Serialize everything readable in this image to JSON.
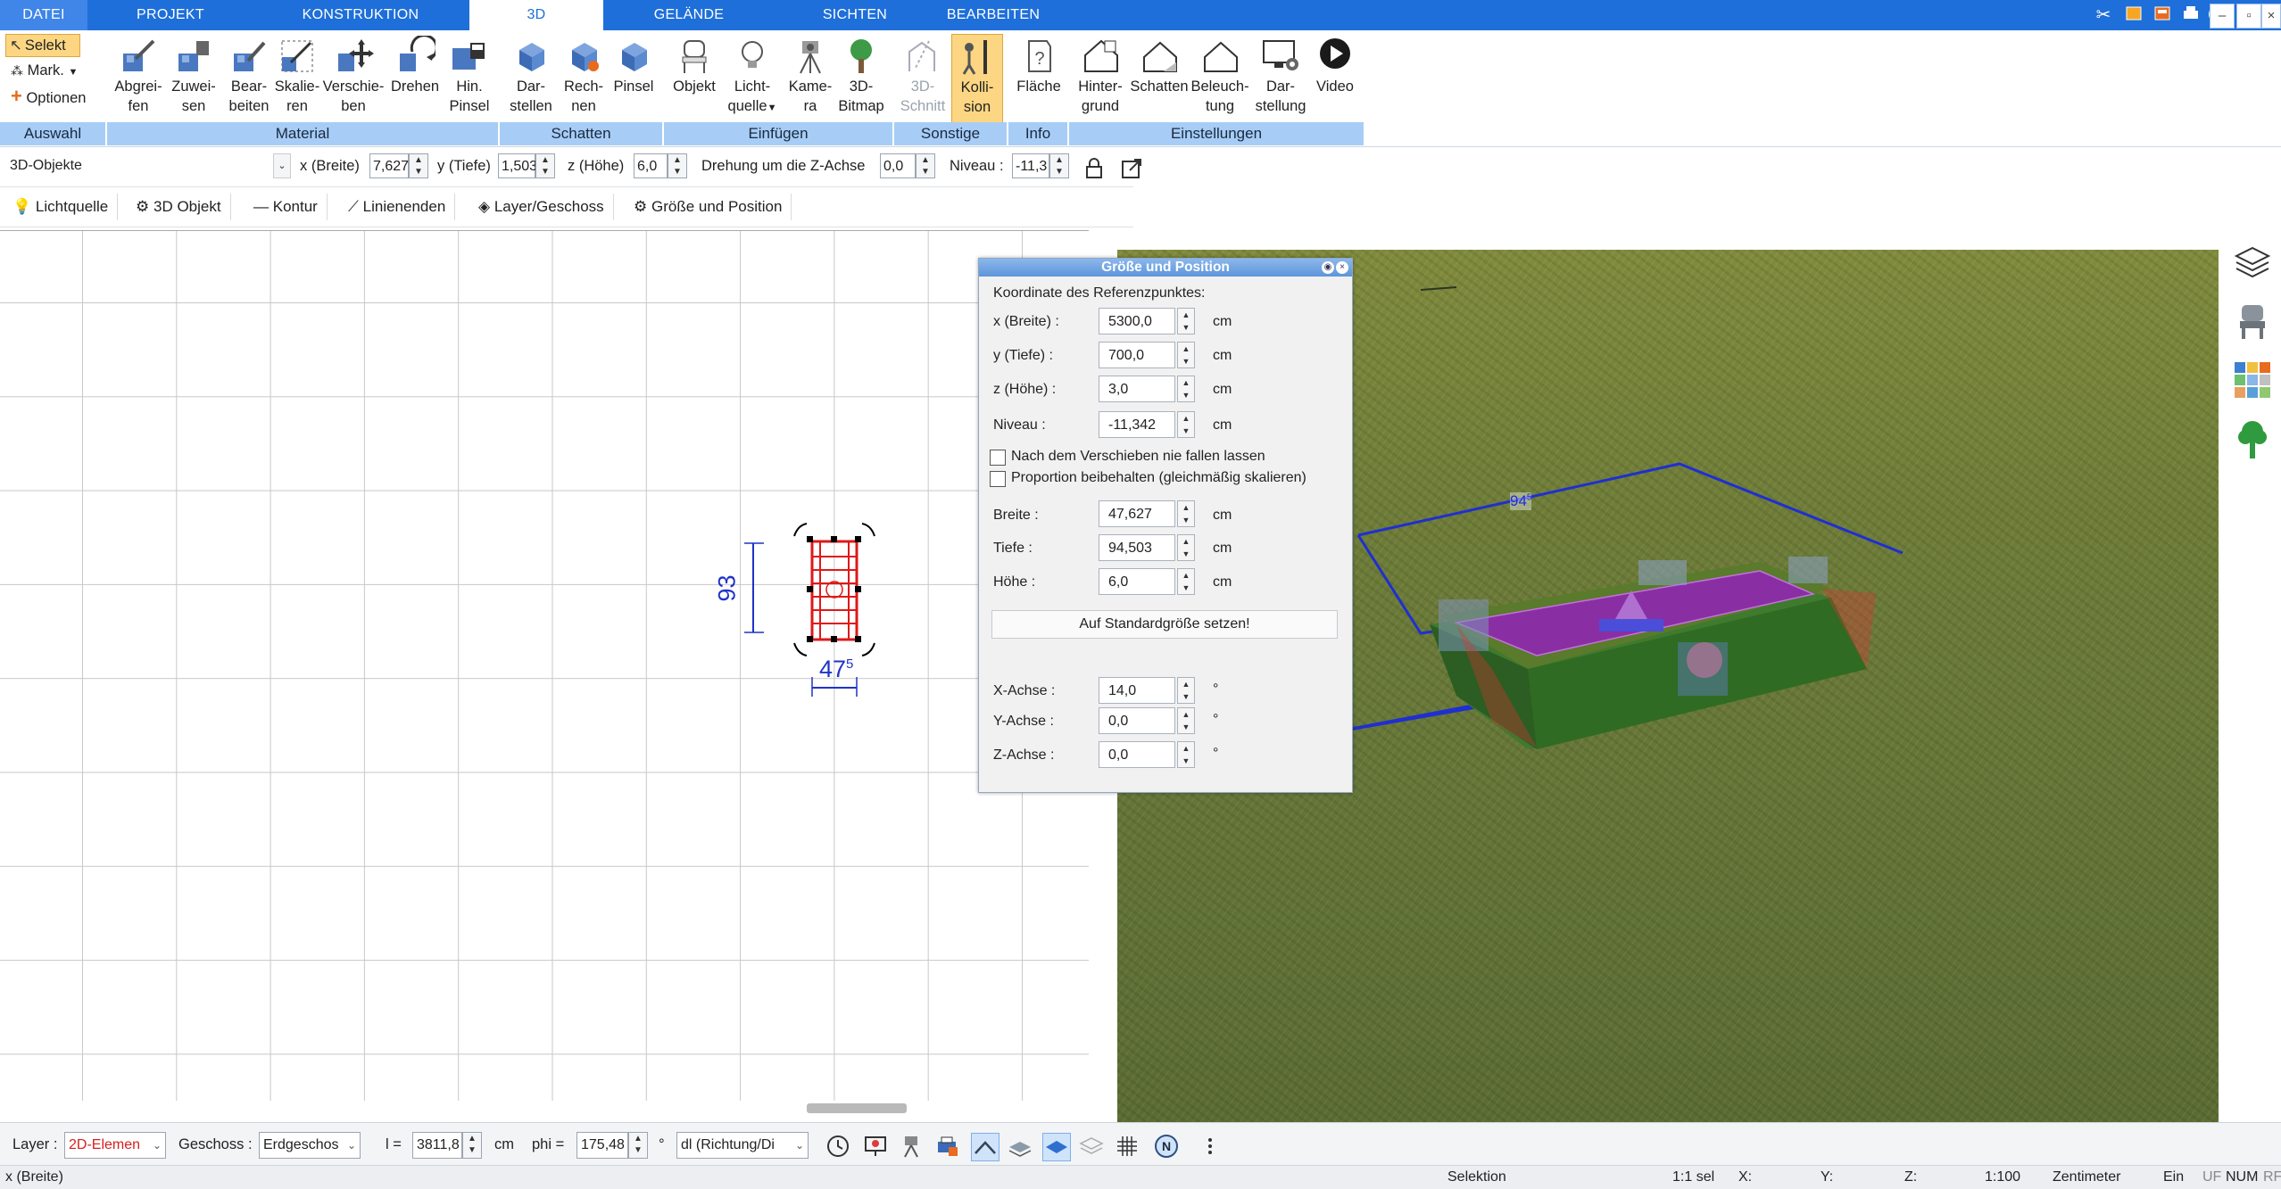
{
  "menu": {
    "tabs": [
      "DATEI",
      "PROJEKT",
      "KONSTRUKTION",
      "3D",
      "GELÄNDE",
      "SICHTEN",
      "BEARBEITEN"
    ],
    "active": "3D"
  },
  "ribbon": {
    "auswahl": {
      "selekt": "Selekt",
      "mark": "Mark.",
      "optionen": "Optionen",
      "group": "Auswahl"
    },
    "material": {
      "group": "Material",
      "buttons": [
        {
          "l1": "Abgrei-",
          "l2": "fen"
        },
        {
          "l1": "Zuwei-",
          "l2": "sen"
        },
        {
          "l1": "Bear-",
          "l2": "beiten"
        },
        {
          "l1": "Skalie-",
          "l2": "ren"
        },
        {
          "l1": "Verschie-",
          "l2": "ben"
        },
        {
          "l1": "Drehen",
          "l2": ""
        },
        {
          "l1": "Hin.",
          "l2": "Pinsel"
        }
      ]
    },
    "schatten": {
      "group": "Schatten",
      "buttons": [
        {
          "l1": "Dar-",
          "l2": "stellen"
        },
        {
          "l1": "Rech-",
          "l2": "nen"
        },
        {
          "l1": "Pinsel",
          "l2": ""
        }
      ]
    },
    "einfuegen": {
      "group": "Einfügen",
      "buttons": [
        {
          "l1": "Objekt",
          "l2": ""
        },
        {
          "l1": "Licht-",
          "l2": "quelle"
        },
        {
          "l1": "Kame-",
          "l2": "ra"
        },
        {
          "l1": "3D-",
          "l2": "Bitmap"
        }
      ]
    },
    "sonstige": {
      "group": "Sonstige",
      "buttons": [
        {
          "l1": "3D-",
          "l2": "Schnitt"
        },
        {
          "l1": "Kolli-",
          "l2": "sion"
        }
      ]
    },
    "info": {
      "group": "Info",
      "buttons": [
        {
          "l1": "Fläche",
          "l2": ""
        }
      ]
    },
    "einstellungen": {
      "group": "Einstellungen",
      "buttons": [
        {
          "l1": "Hinter-",
          "l2": "grund"
        },
        {
          "l1": "Schatten",
          "l2": ""
        },
        {
          "l1": "Beleuch-",
          "l2": "tung"
        },
        {
          "l1": "Dar-",
          "l2": "stellung"
        },
        {
          "l1": "Video",
          "l2": ""
        }
      ]
    }
  },
  "propbar": {
    "object_type": "3D-Objekte",
    "x_label": "x (Breite)",
    "x_value": "7,627",
    "y_label": "y (Tiefe)",
    "y_value": "1,503",
    "z_label": "z (Höhe)",
    "z_value": "6,0",
    "rot_label": "Drehung um die Z-Achse",
    "rot_value": "0,0",
    "niveau_label": "Niveau :",
    "niveau_value": "-11,3"
  },
  "toolbar2": [
    "Lichtquelle",
    "3D Objekt",
    "Kontur",
    "Linienenden",
    "Layer/Geschoss",
    "Größe und Position"
  ],
  "plan2d": {
    "dim_vertical": "93",
    "dim_horizontal_main": "47",
    "dim_horizontal_sup": "5"
  },
  "view3d": {
    "dim_main": "94",
    "dim_sup": "5"
  },
  "dialog": {
    "title": "Größe und Position",
    "ref_heading": "Koordinate des Referenzpunktes:",
    "unit": "cm",
    "deg": "°",
    "coords": [
      {
        "label": "x (Breite) :",
        "value": "5300,0"
      },
      {
        "label": "y (Tiefe) :",
        "value": "700,0"
      },
      {
        "label": "z (Höhe) :",
        "value": "3,0"
      },
      {
        "label": "Niveau :",
        "value": "-11,342"
      }
    ],
    "check1": "Nach dem Verschieben nie fallen lassen",
    "check2": "Proportion beibehalten (gleichmäßig skalieren)",
    "sizes": [
      {
        "label": "Breite :",
        "value": "47,627"
      },
      {
        "label": "Tiefe :",
        "value": "94,503"
      },
      {
        "label": "Höhe :",
        "value": "6,0"
      }
    ],
    "std_button": "Auf Standardgröße setzen!",
    "axes": [
      {
        "label": "X-Achse :",
        "value": "14,0"
      },
      {
        "label": "Y-Achse :",
        "value": "0,0"
      },
      {
        "label": "Z-Achse :",
        "value": "0,0"
      }
    ]
  },
  "statusbar": {
    "layer_label": "Layer :",
    "layer_value": "2D-Elemen",
    "geschoss_label": "Geschoss :",
    "geschoss_value": "Erdgeschos",
    "l_label": "l =",
    "l_value": "3811,8",
    "l_unit": "cm",
    "phi_label": "phi =",
    "phi_value": "175,48",
    "phi_unit": "°",
    "dl_value": "dl (Richtung/Di"
  },
  "statusline": {
    "left": "x (Breite)",
    "mode": "Selektion",
    "sel": "1:1 sel",
    "x": "X:",
    "y": "Y:",
    "z": "Z:",
    "scale": "1:100",
    "unit": "Zentimeter",
    "ein": "Ein",
    "uf": "UF",
    "num": "NUM",
    "rf": "RF"
  },
  "colors": {
    "menu_bar": "#1e6fd9",
    "group_label_bg": "#a7cdf6",
    "highlight": "#fcd683",
    "dimension_blue": "#1f33c9",
    "object_red": "#e01818",
    "grass": "#72813a"
  }
}
